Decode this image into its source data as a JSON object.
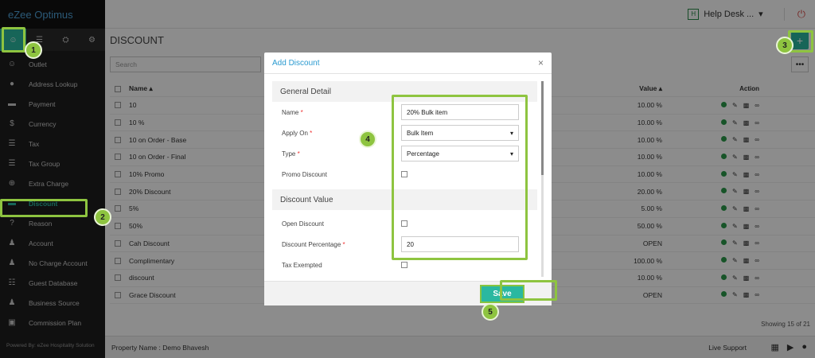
{
  "app": {
    "logo": "eZee Optimus",
    "powered_by": "Powered By: eZee Hospitality Solution"
  },
  "topbar": {
    "badge": "H",
    "helpdesk": "Help Desk ...",
    "caret": "▾"
  },
  "page": {
    "title": "DISCOUNT",
    "search_placeholder": "Search",
    "showing": "Showing 15 of 21"
  },
  "sidebar": {
    "items": [
      {
        "label": "Outlet",
        "icon": "user-icon"
      },
      {
        "label": "Address Lookup",
        "icon": "map-pin-icon"
      },
      {
        "label": "Payment",
        "icon": "card-icon"
      },
      {
        "label": "Currency",
        "icon": "dollar-icon"
      },
      {
        "label": "Tax",
        "icon": "tax-icon"
      },
      {
        "label": "Tax Group",
        "icon": "list-icon"
      },
      {
        "label": "Extra Charge",
        "icon": "plus-circle-icon"
      },
      {
        "label": "Discount",
        "icon": "tag-icon"
      },
      {
        "label": "Reason",
        "icon": "question-icon"
      },
      {
        "label": "Account",
        "icon": "person-icon"
      },
      {
        "label": "No Charge Account",
        "icon": "person-icon"
      },
      {
        "label": "Guest Database",
        "icon": "database-icon"
      },
      {
        "label": "Business Source",
        "icon": "group-icon"
      },
      {
        "label": "Commission Plan",
        "icon": "money-icon"
      }
    ]
  },
  "table": {
    "headers": {
      "name": "Name ▴",
      "value": "Value ▴",
      "action": "Action"
    },
    "rows": [
      {
        "name": "10",
        "value": "10.00 %"
      },
      {
        "name": "10 %",
        "value": "10.00 %"
      },
      {
        "name": "10 on Order - Base",
        "value": "10.00 %"
      },
      {
        "name": "10 on Order - Final",
        "value": "10.00 %"
      },
      {
        "name": "10% Promo",
        "value": "10.00 %"
      },
      {
        "name": "20% Discount",
        "value": "20.00 %"
      },
      {
        "name": "5%",
        "value": "5.00 %"
      },
      {
        "name": "50%",
        "value": "50.00 %"
      },
      {
        "name": "Cah Discount",
        "value": "OPEN"
      },
      {
        "name": "Complimentary",
        "value": "100.00 %"
      },
      {
        "name": "discount",
        "value": "10.00 %"
      },
      {
        "name": "Grace Discount",
        "value": "OPEN"
      }
    ]
  },
  "footer": {
    "property": "Property Name : Demo Bhavesh",
    "live_support": "Live Support"
  },
  "modal": {
    "title": "Add Discount",
    "close": "×",
    "section_general": "General Detail",
    "name_label": "Name",
    "name_value": "20% Bulk item",
    "apply_label": "Apply On",
    "apply_value": "Bulk Item",
    "type_label": "Type",
    "type_value": "Percentage",
    "promo_label": "Promo Discount",
    "section_value": "Discount Value",
    "open_label": "Open Discount",
    "percent_label": "Discount Percentage",
    "percent_value": "20",
    "tax_label": "Tax Exempted",
    "save": "Save",
    "required_mark": "*",
    "dropdown_caret": "▾"
  },
  "callouts": [
    "1",
    "2",
    "3",
    "4",
    "5"
  ],
  "colors": {
    "accent": "#2ab8a0",
    "highlight": "#8ec440",
    "link": "#2a9ad0"
  }
}
